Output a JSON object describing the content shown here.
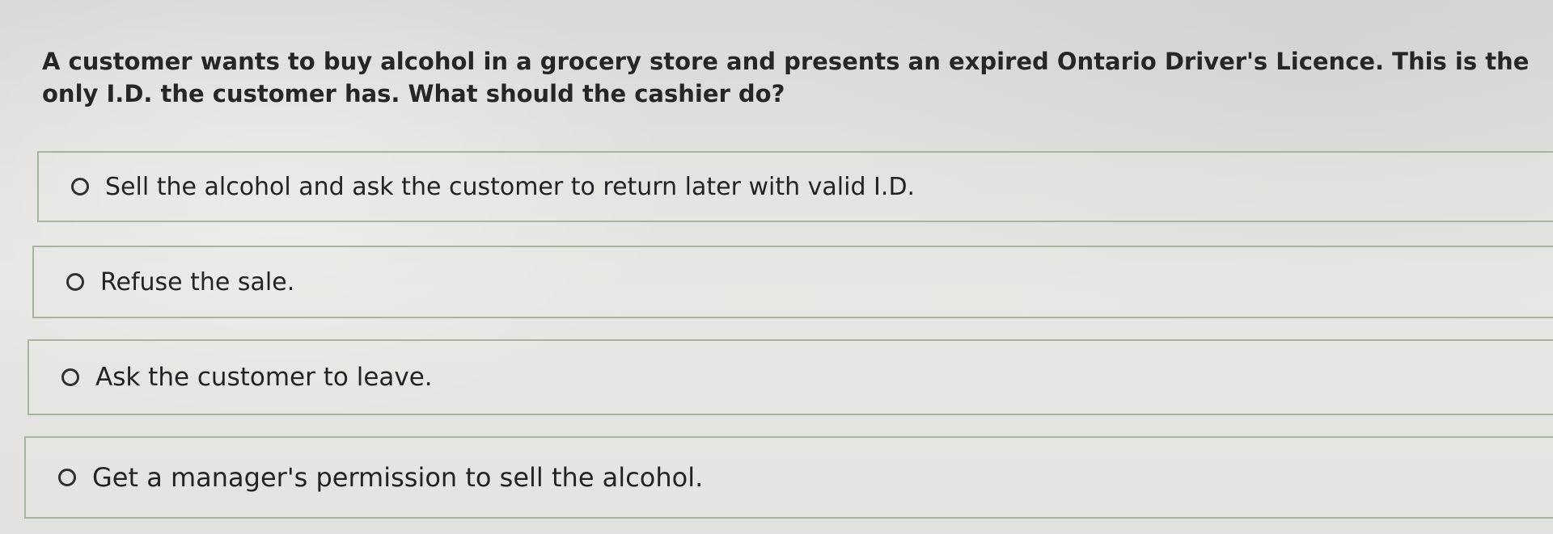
{
  "question": {
    "text": "A customer wants to buy alcohol in a grocery store and presents an expired Ontario Driver's Licence. This is the only I.D. the customer has. What should the cashier do?"
  },
  "options": [
    {
      "label": "Sell the alcohol and ask the customer to return later with valid I.D.",
      "selected": false
    },
    {
      "label": "Refuse the sale.",
      "selected": false
    },
    {
      "label": "Ask the customer to leave.",
      "selected": false
    },
    {
      "label": "Get a manager's permission to sell the alcohol.",
      "selected": false
    }
  ],
  "colors": {
    "option_border": "#a7b5a0",
    "text": "#232323"
  },
  "icons": {
    "radio": "radio-button-unselected-icon"
  }
}
